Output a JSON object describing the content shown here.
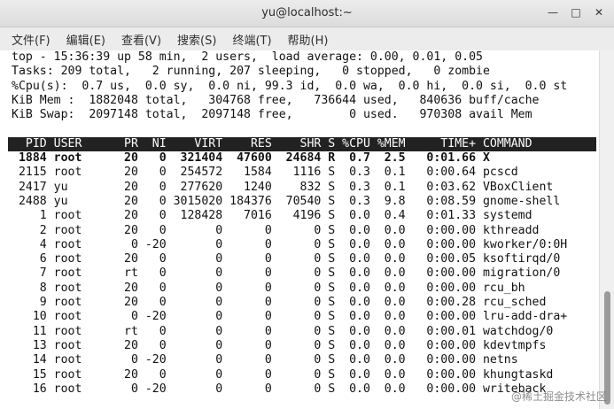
{
  "window": {
    "title": "yu@localhost:~",
    "minimize_glyph": "—",
    "maximize_glyph": "□",
    "close_glyph": "✕"
  },
  "menu": [
    "文件(F)",
    "编辑(E)",
    "查看(V)",
    "搜索(S)",
    "终端(T)",
    "帮助(H)"
  ],
  "summary": [
    "top - 15:36:39 up 58 min,  2 users,  load average: 0.00, 0.01, 0.05",
    "Tasks: 209 total,   2 running, 207 sleeping,   0 stopped,   0 zombie",
    "%Cpu(s):  0.7 us,  0.0 sy,  0.0 ni, 99.3 id,  0.0 wa,  0.0 hi,  0.0 si,  0.0 st",
    "KiB Mem :  1882048 total,   304768 free,   736644 used,   840636 buff/cache",
    "KiB Swap:  2097148 total,  2097148 free,        0 used.   970308 avail Mem"
  ],
  "header": "  PID USER      PR  NI    VIRT    RES    SHR S %CPU %MEM     TIME+ COMMAND",
  "processes": [
    {
      "text": " 1884 root      20   0  321404  47600  24684 R  0.7  2.5   0:01.66 X",
      "bold": true
    },
    {
      "text": " 2115 root      20   0  254572   1584   1116 S  0.3  0.1   0:00.64 pcscd",
      "bold": false
    },
    {
      "text": " 2417 yu        20   0  277620   1240    832 S  0.3  0.1   0:03.62 VBoxClient",
      "bold": false
    },
    {
      "text": " 2488 yu        20   0 3015020 184376  70540 S  0.3  9.8   0:08.59 gnome-shell",
      "bold": false
    },
    {
      "text": "    1 root      20   0  128428   7016   4196 S  0.0  0.4   0:01.33 systemd",
      "bold": false
    },
    {
      "text": "    2 root      20   0       0      0      0 S  0.0  0.0   0:00.00 kthreadd",
      "bold": false
    },
    {
      "text": "    4 root       0 -20       0      0      0 S  0.0  0.0   0:00.00 kworker/0:0H",
      "bold": false
    },
    {
      "text": "    6 root      20   0       0      0      0 S  0.0  0.0   0:00.05 ksoftirqd/0",
      "bold": false
    },
    {
      "text": "    7 root      rt   0       0      0      0 S  0.0  0.0   0:00.00 migration/0",
      "bold": false
    },
    {
      "text": "    8 root      20   0       0      0      0 S  0.0  0.0   0:00.00 rcu_bh",
      "bold": false
    },
    {
      "text": "    9 root      20   0       0      0      0 S  0.0  0.0   0:00.28 rcu_sched",
      "bold": false
    },
    {
      "text": "   10 root       0 -20       0      0      0 S  0.0  0.0   0:00.00 lru-add-dra+",
      "bold": false
    },
    {
      "text": "   11 root      rt   0       0      0      0 S  0.0  0.0   0:00.01 watchdog/0",
      "bold": false
    },
    {
      "text": "   13 root      20   0       0      0      0 S  0.0  0.0   0:00.00 kdevtmpfs",
      "bold": false
    },
    {
      "text": "   14 root       0 -20       0      0      0 S  0.0  0.0   0:00.00 netns",
      "bold": false
    },
    {
      "text": "   15 root      20   0       0      0      0 S  0.0  0.0   0:00.00 khungtaskd",
      "bold": false
    },
    {
      "text": "   16 root       0 -20       0      0      0 S  0.0  0.0   0:00.00 writeback",
      "bold": false
    }
  ],
  "watermark": "@稀土掘金技术社区"
}
